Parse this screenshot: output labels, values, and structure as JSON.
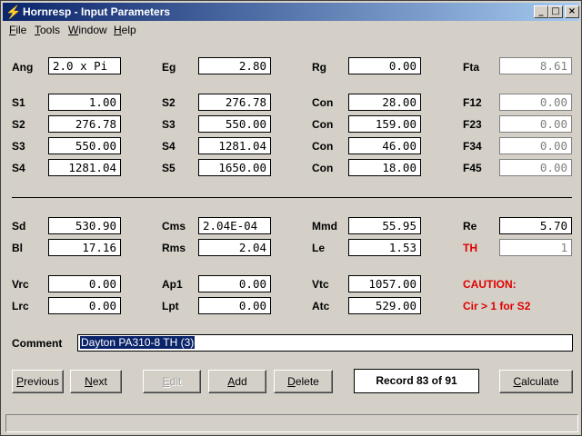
{
  "window": {
    "title": "Hornresp - Input Parameters",
    "icon": "lightning-bolt-icon",
    "controls": {
      "minimize": "_",
      "maximize": "□",
      "close": "×"
    }
  },
  "menu": {
    "items": [
      {
        "first": "F",
        "rest": "ile"
      },
      {
        "first": "T",
        "rest": "ools"
      },
      {
        "first": "W",
        "rest": "indow"
      },
      {
        "first": "H",
        "rest": "elp"
      }
    ]
  },
  "col1": {
    "ang": {
      "label": "Ang",
      "value": "2.0 x Pi"
    },
    "s1": {
      "label": "S1",
      "value": "1.00"
    },
    "s2": {
      "label": "S2",
      "value": "276.78"
    },
    "s3": {
      "label": "S3",
      "value": "550.00"
    },
    "s4": {
      "label": "S4",
      "value": "1281.04"
    },
    "sd": {
      "label": "Sd",
      "value": "530.90"
    },
    "bl": {
      "label": "Bl",
      "value": "17.16"
    },
    "vrc": {
      "label": "Vrc",
      "value": "0.00"
    },
    "lrc": {
      "label": "Lrc",
      "value": "0.00"
    }
  },
  "col2": {
    "eg": {
      "label": "Eg",
      "value": "2.80"
    },
    "s2": {
      "label": "S2",
      "value": "276.78"
    },
    "s3": {
      "label": "S3",
      "value": "550.00"
    },
    "s4": {
      "label": "S4",
      "value": "1281.04"
    },
    "s5": {
      "label": "S5",
      "value": "1650.00"
    },
    "cms": {
      "label": "Cms",
      "value": "2.04E-04"
    },
    "rms": {
      "label": "Rms",
      "value": "2.04"
    },
    "ap1": {
      "label": "Ap1",
      "value": "0.00"
    },
    "lpt": {
      "label": "Lpt",
      "value": "0.00"
    }
  },
  "col3": {
    "rg": {
      "label": "Rg",
      "value": "0.00"
    },
    "con1": {
      "label": "Con",
      "value": "28.00"
    },
    "con2": {
      "label": "Con",
      "value": "159.00"
    },
    "con3": {
      "label": "Con",
      "value": "46.00"
    },
    "con4": {
      "label": "Con",
      "value": "18.00"
    },
    "mmd": {
      "label": "Mmd",
      "value": "55.95"
    },
    "le": {
      "label": "Le",
      "value": "1.53"
    },
    "vtc": {
      "label": "Vtc",
      "value": "1057.00"
    },
    "atc": {
      "label": "Atc",
      "value": "529.00"
    }
  },
  "col4": {
    "fta": {
      "label": "Fta",
      "value": "8.61"
    },
    "f12": {
      "label": "F12",
      "value": "0.00"
    },
    "f23": {
      "label": "F23",
      "value": "0.00"
    },
    "f34": {
      "label": "F34",
      "value": "0.00"
    },
    "f45": {
      "label": "F45",
      "value": "0.00"
    },
    "re": {
      "label": "Re",
      "value": "5.70"
    },
    "th": {
      "label": "TH",
      "value": "1"
    },
    "caution": "CAUTION:",
    "caution_msg": "Cir > 1 for S2"
  },
  "comment": {
    "label": "Comment",
    "value": "Dayton PA310-8 TH (3)"
  },
  "buttons": {
    "previous": {
      "first": "P",
      "rest": "revious"
    },
    "next": {
      "first": "N",
      "rest": "ext"
    },
    "edit": {
      "first": "E",
      "rest": "dit"
    },
    "add": {
      "first": "A",
      "rest": "dd"
    },
    "delete": {
      "first": "D",
      "rest": "elete"
    },
    "calculate": {
      "first": "C",
      "rest": "alculate"
    }
  },
  "record": "Record 83 of 91",
  "colors": {
    "accent": "#0a246a",
    "warning": "#e00000",
    "background": "#d4d0c8"
  }
}
